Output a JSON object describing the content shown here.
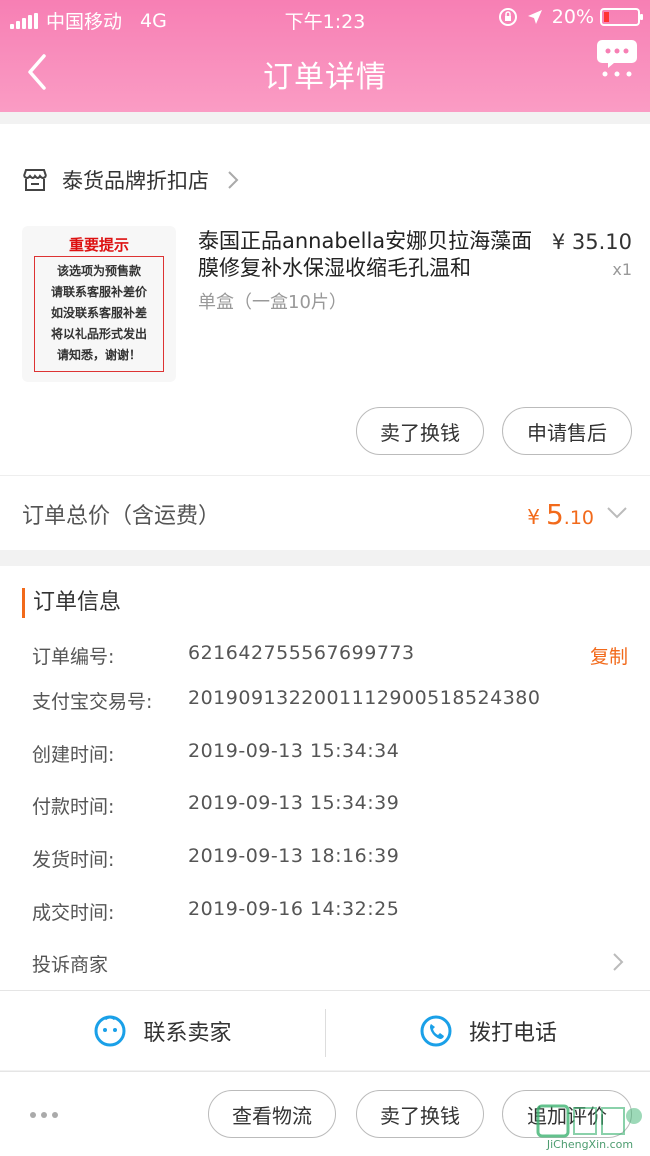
{
  "status_bar": {
    "carrier": "中国移动",
    "network": "4G",
    "time": "下午1:23",
    "battery": "20%"
  },
  "nav": {
    "title": "订单详情"
  },
  "shop": {
    "name": "泰货品牌折扣店"
  },
  "product": {
    "image_title": "重要提示",
    "image_lines": [
      "该选项为预售款",
      "请联系客服补差价",
      "如没联系客服补差",
      "将以礼品形式发出",
      "请知悉，谢谢！"
    ],
    "title": "泰国正品annabella安娜贝拉海藻面膜修复补水保湿收缩毛孔温和",
    "spec": "单盒（一盒10片）",
    "price": "¥ 35.10",
    "qty": "x1"
  },
  "item_actions": {
    "resell_label": "卖了换钱",
    "after_sale_label": "申请售后"
  },
  "total": {
    "label": "订单总价（含运费）",
    "currency": "¥",
    "int_part": "5",
    "dec_part": ".10"
  },
  "order_info": {
    "title": "订单信息",
    "copy_label": "复制",
    "rows": [
      {
        "label": "订单编号:",
        "value": "621642755567699773"
      },
      {
        "label": "支付宝交易号:",
        "value": "2019091322001112900518524380"
      },
      {
        "label": "创建时间:",
        "value": "2019-09-13 15:34:34"
      },
      {
        "label": "付款时间:",
        "value": "2019-09-13 15:34:39"
      },
      {
        "label": "发货时间:",
        "value": "2019-09-13 18:16:39"
      },
      {
        "label": "成交时间:",
        "value": "2019-09-16 14:32:25"
      }
    ],
    "complaint_label": "投诉商家"
  },
  "contact": {
    "seller_label": "联系卖家",
    "call_label": "拨打电话"
  },
  "bottom_bar": {
    "logistics_label": "查看物流",
    "resell_label": "卖了换钱",
    "review_label": "追加评价"
  },
  "watermark": {
    "text": "JiChengXin.com"
  },
  "colors": {
    "header": "#f77fb4",
    "accent": "#f26a1b"
  }
}
